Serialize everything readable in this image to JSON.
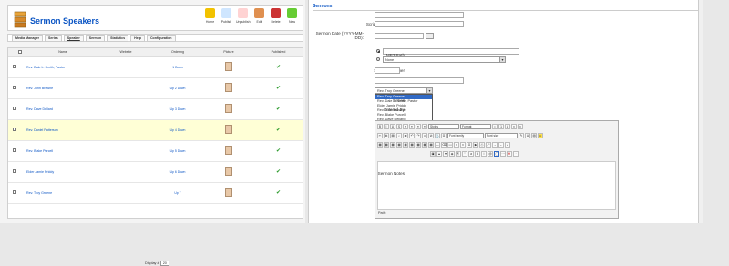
{
  "header": {
    "title": "Sermon Speakers"
  },
  "toolbar": [
    {
      "label": "Home",
      "icon": "star-icon",
      "color": "#f2c200"
    },
    {
      "label": "Publish",
      "icon": "publish-icon",
      "color": "#cfe6ff"
    },
    {
      "label": "Unpublish",
      "icon": "unpublish-icon",
      "color": "#ffd3d3"
    },
    {
      "label": "Edit",
      "icon": "pencil-icon",
      "color": "#e09050"
    },
    {
      "label": "Delete",
      "icon": "trash-icon",
      "color": "#cc3333"
    },
    {
      "label": "New",
      "icon": "plus-icon",
      "color": "#66cc33"
    }
  ],
  "submenu": [
    "Media Manager",
    "Series",
    "Speaker",
    "Sermon",
    "Statistics",
    "Help",
    "Configuration"
  ],
  "table": {
    "headers": [
      "Name",
      "Website",
      "Ordering",
      "Picture",
      "Published"
    ],
    "rows": [
      {
        "name": "Rev. Dale L. Smith, Pastor",
        "order": "1 Down"
      },
      {
        "name": "Rev. John Browne",
        "order": "Up 2 Down"
      },
      {
        "name": "Rev. Dave Dellard",
        "order": "Up 3 Down"
      },
      {
        "name": "Rev. Daniel Patterson",
        "order": "Up 4 Down"
      },
      {
        "name": "Rev. Blake Purcell",
        "order": "Up 5 Down"
      },
      {
        "name": "Elder Jamie Priddy",
        "order": "Up 6 Down"
      },
      {
        "name": "Rev. Troy Greene",
        "order": "Up 7"
      }
    ],
    "pager_label": "Display #",
    "pager_value": "20"
  },
  "form": {
    "section_title": "Sermons",
    "labels": {
      "title": "Sermon Title",
      "scripture": "Scripture Reference:",
      "date": "Sermon Date (YYYY-MM-DD):",
      "mp3": "MP3 Path",
      "number": "Sermon Number",
      "time": "Time",
      "speaker": "Speaker",
      "series": "Series",
      "entered": "Entered By",
      "notes": "Sermon Notes"
    },
    "date_button": "...",
    "mp3_select": "None",
    "speaker_value": "Rev. Troy Greene",
    "speaker_options": [
      "Rev. Troy Greene",
      "Rev. Dale L. Smith, Pastor",
      "Elder Jamie Priddy",
      "Rev. John Browne",
      "Rev. Blake Purcell",
      "Rev. Dave Dellard",
      "Rev. Daniel Patterson"
    ],
    "editor": {
      "styles": "Styles",
      "format": "Format",
      "font_family": "Font family",
      "font_size": "Font size",
      "path_label": "Path:"
    }
  }
}
